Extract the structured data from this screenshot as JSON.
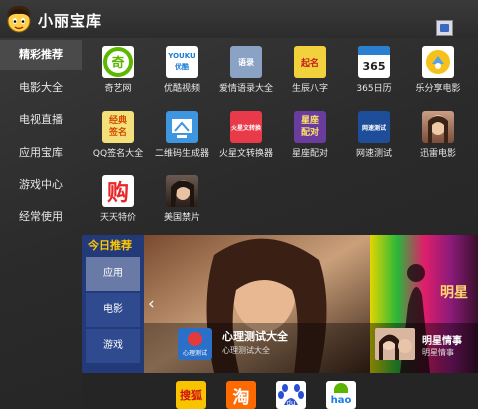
{
  "app": {
    "title": "小丽宝库"
  },
  "sidebar": {
    "items": [
      {
        "label": "精彩推荐"
      },
      {
        "label": "电影大全"
      },
      {
        "label": "电视直播"
      },
      {
        "label": "应用宝库"
      },
      {
        "label": "游戏中心"
      },
      {
        "label": "经常使用"
      }
    ]
  },
  "apps": [
    {
      "label": "奇艺网",
      "icon_text": "奇"
    },
    {
      "label": "优酷视频",
      "icon_text": "YOUKU\n优酷"
    },
    {
      "label": "爱情语录大全",
      "icon_text": "语录"
    },
    {
      "label": "生辰八字",
      "icon_text": "起名"
    },
    {
      "label": "365日历",
      "icon_text": "365"
    },
    {
      "label": "乐分享电影",
      "icon_text": ""
    },
    {
      "label": "QQ签名大全",
      "icon_text": "经典\n签名"
    },
    {
      "label": "二维码生成器",
      "icon_text": ""
    },
    {
      "label": "火星文转换器",
      "icon_text": "火星文转换"
    },
    {
      "label": "星座配对",
      "icon_text": "星座\n配对"
    },
    {
      "label": "网速测试",
      "icon_text": "网速测试"
    },
    {
      "label": "迅雷电影",
      "icon_text": ""
    },
    {
      "label": "天天特价",
      "icon_text": "购"
    },
    {
      "label": "美国禁片",
      "icon_text": ""
    }
  ],
  "today": {
    "title": "今日推荐",
    "buttons": [
      {
        "label": "应用"
      },
      {
        "label": "电影"
      },
      {
        "label": "游戏"
      }
    ]
  },
  "banner": {
    "arrow": "‹",
    "feature1": {
      "title": "心理测试大全",
      "subtitle": "心理测试大全",
      "icon_text": "心理测试"
    },
    "feature2": {
      "title": "明星情事",
      "subtitle": "明星情事",
      "side_text": "明星"
    }
  },
  "bottom_icons": [
    {
      "name": "sohu",
      "text": "搜狐"
    },
    {
      "name": "taobao",
      "text": "淘"
    },
    {
      "name": "baidu",
      "text": "du"
    },
    {
      "name": "hao123",
      "text": "hao"
    }
  ],
  "colors": {
    "accent": "#ffc700",
    "today_bg": "#233a78"
  }
}
